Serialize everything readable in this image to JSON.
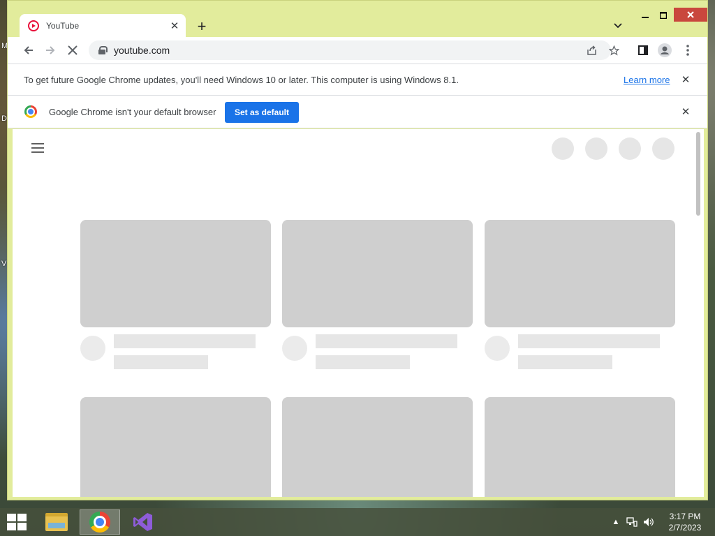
{
  "desktop": {
    "edge_letters": [
      "M",
      "D",
      "V"
    ]
  },
  "browser": {
    "tab": {
      "title": "YouTube",
      "favicon": "youtube-icon",
      "close_glyph": "✕"
    },
    "new_tab_glyph": "+",
    "tab_search_glyph": "⌄",
    "window_controls": {
      "minimize": "—",
      "maximize": "☐",
      "close": "✕"
    },
    "toolbar": {
      "back_glyph": "←",
      "forward_glyph": "→",
      "stop_glyph": "✕",
      "url": "youtube.com",
      "share_glyph": "⇪",
      "bookmark_glyph": "☆",
      "side_panel_glyph": "◧",
      "menu_glyph": "⋮"
    },
    "infobar_update": {
      "text": "To get future Google Chrome updates, you'll need Windows 10 or later. This computer is using Windows 8.1.",
      "link": "Learn more",
      "close_glyph": "✕"
    },
    "infobar_default": {
      "text": "Google Chrome isn't your default browser",
      "button": "Set as default",
      "close_glyph": "✕"
    }
  },
  "taskbar": {
    "apps": [
      {
        "name": "file-explorer"
      },
      {
        "name": "google-chrome",
        "active": true
      },
      {
        "name": "visual-studio"
      }
    ],
    "tray": {
      "chevron_glyph": "▲"
    },
    "clock": {
      "time": "3:17 PM",
      "date": "2/7/2023"
    }
  },
  "colors": {
    "window_frame": "#e2ec9c",
    "accent_button": "#1a73e8",
    "close_button": "#c9473d",
    "skeleton": "#cfcfcf"
  }
}
